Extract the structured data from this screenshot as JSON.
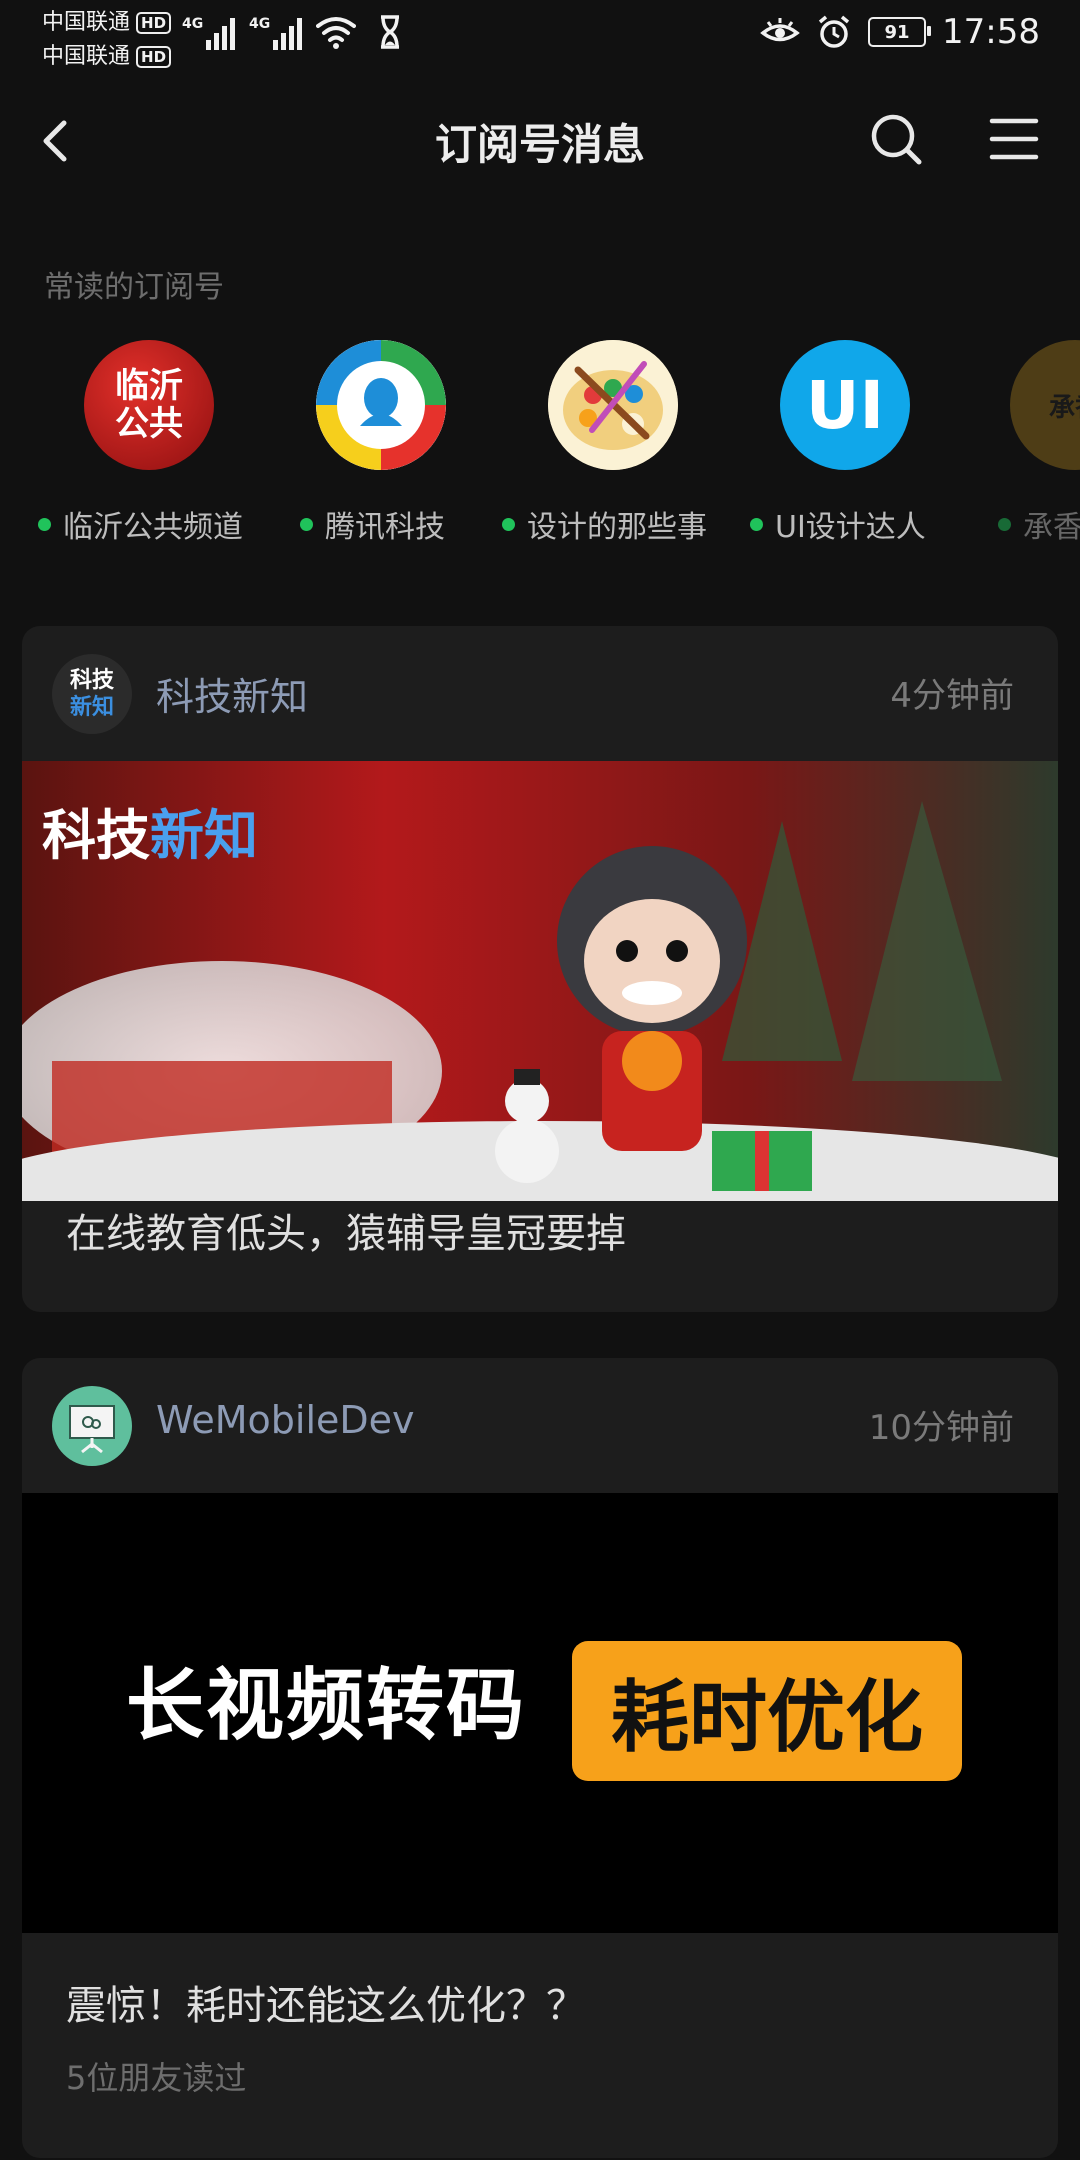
{
  "status_bar": {
    "carrier_1": "中国联通",
    "carrier_2": "中国联通",
    "hd": "HD",
    "net_1": "4G",
    "net_2": "4G",
    "battery": "91",
    "time": "17:58"
  },
  "nav": {
    "title": "订阅号消息",
    "icons": [
      "back-icon",
      "search-icon",
      "menu-icon"
    ]
  },
  "frequent": {
    "title": "常读的订阅号",
    "items": [
      {
        "label": "临沂公共频道",
        "avatar_text_1": "临沂",
        "avatar_text_2": "公共"
      },
      {
        "label": "腾讯科技"
      },
      {
        "label": "设计的那些事"
      },
      {
        "label": "UI设计达人",
        "avatar_text": "UI"
      },
      {
        "label": "承香",
        "avatar_text": "承香"
      }
    ]
  },
  "cards": [
    {
      "account": "科技新知",
      "avatar_text_1": "科技",
      "avatar_text_2": "新知",
      "time": "4分钟前",
      "cover_text_1": "科技",
      "cover_text_2": "新知",
      "title": "在线教育低头，猿辅导皇冠要掉"
    },
    {
      "account": "WeMobileDev",
      "time": "10分钟前",
      "cover_text_1": "长视频转码",
      "cover_text_2": "耗时优化",
      "title": "震惊！耗时还能这么优化？？",
      "meta": "5位朋友读过"
    }
  ],
  "colors": {
    "background": "#111111",
    "card": "#1d1d1d",
    "online_dot": "#20c35b",
    "account_name": "#8d9bb5",
    "highlight_orange": "#f7a11a"
  }
}
